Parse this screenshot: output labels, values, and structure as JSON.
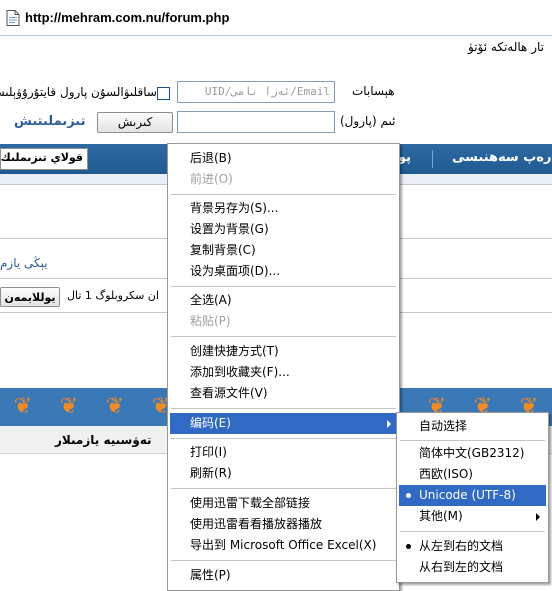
{
  "address_bar": {
    "url": "http://mehram.com.nu/forum.php"
  },
  "breadcrumb": {
    "text": "تار ھالەتكە ئۆتۈ"
  },
  "login": {
    "account_label": "ھېسابات",
    "account_placeholder": "UID/ئەزا نامى/Email",
    "remember_label": "ساقلىۋالسۇن",
    "find_password_label": "پارول قايتۇرۇۋېلىش",
    "password_label": "ئىم (پارول)",
    "login_button": "كىرىش",
    "register_link": "تىزىملىتىش"
  },
  "nav": {
    "left_button": "قولاي تىزىملىك",
    "items": [
      "پو",
      "شەرەپ سەھنىسى"
    ]
  },
  "content": {
    "link_text": "يېڭى يازم",
    "info_text": "ان سكروبلوگ 1 تال",
    "online_button": "يوللايمەن",
    "table_header": "تەۋسىيە يازمىلار"
  },
  "context_menu": {
    "items": [
      {
        "label": "后退(B)",
        "disabled": false
      },
      {
        "label": "前进(O)",
        "disabled": true
      },
      {
        "label": "背景另存为(S)...",
        "disabled": false
      },
      {
        "label": "设置为背景(G)",
        "disabled": false
      },
      {
        "label": "复制背景(C)",
        "disabled": false
      },
      {
        "label": "设为桌面项(D)...",
        "disabled": false
      },
      {
        "label": "全选(A)",
        "disabled": false
      },
      {
        "label": "粘贴(P)",
        "disabled": true
      },
      {
        "label": "创建快捷方式(T)",
        "disabled": false
      },
      {
        "label": "添加到收藏夹(F)...",
        "disabled": false
      },
      {
        "label": "查看源文件(V)",
        "disabled": false
      },
      {
        "label": "编码(E)",
        "disabled": false,
        "submenu": true,
        "highlighted": true
      },
      {
        "label": "打印(I)",
        "disabled": false
      },
      {
        "label": "刷新(R)",
        "disabled": false
      },
      {
        "label": "使用迅雷下载全部链接",
        "disabled": false
      },
      {
        "label": "使用迅雷看看播放器播放",
        "disabled": false
      },
      {
        "label": "导出到 Microsoft Office Excel(X)",
        "disabled": false
      },
      {
        "label": "属性(P)",
        "disabled": false
      }
    ]
  },
  "encoding_submenu": {
    "items": [
      {
        "label": "自动选择"
      },
      {
        "label": "简体中文(GB2312)"
      },
      {
        "label": "西欧(ISO)"
      },
      {
        "label": "Unicode (UTF-8)",
        "selected": true,
        "highlighted": true
      },
      {
        "label": "其他(M)",
        "submenu": true
      },
      {
        "label": "从左到右的文档",
        "selected": true
      },
      {
        "label": "从右到左的文档"
      }
    ]
  },
  "colors": {
    "nav_bar": "#2f6aa3",
    "menu_highlight": "#316ac5",
    "link": "#2a5d9a",
    "ornament_bg": "#3b78b6",
    "ornament_fg": "#f08a24"
  }
}
